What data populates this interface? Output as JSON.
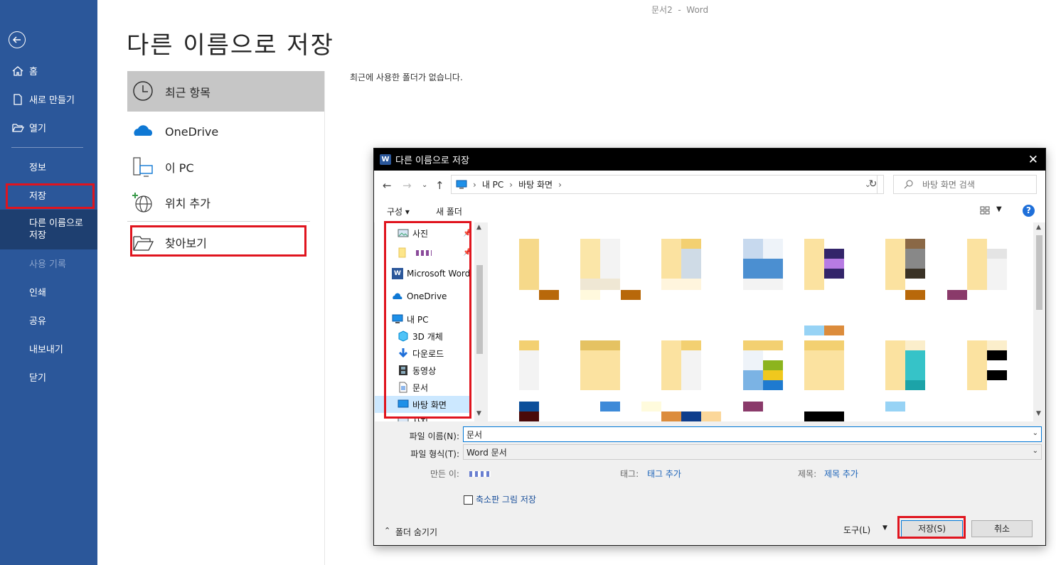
{
  "app_title": "문서2  -  Word",
  "page_title": "다른 이름으로 저장",
  "backstage_nav": {
    "items": [
      {
        "label": "홈"
      },
      {
        "label": "새로 만들기"
      },
      {
        "label": "열기"
      },
      {
        "label": "정보"
      },
      {
        "label": "저장"
      },
      {
        "label": "다른 이름으로\n저장"
      },
      {
        "label": "사용 기록"
      },
      {
        "label": "인쇄"
      },
      {
        "label": "공유"
      },
      {
        "label": "내보내기"
      },
      {
        "label": "닫기"
      }
    ]
  },
  "locations": {
    "recent": "최근 항목",
    "onedrive": "OneDrive",
    "this_pc": "이 PC",
    "add_place": "위치 추가",
    "browse": "찾아보기"
  },
  "empty_message": "최근에 사용한 폴더가 없습니다.",
  "dialog": {
    "title": "다른 이름으로 저장",
    "close": "✕",
    "address": {
      "root": "내 PC",
      "folder": "바탕 화면"
    },
    "search_placeholder": "바탕 화면 검색",
    "cmd": {
      "organize": "구성 ▾",
      "new_folder": "새 폴더"
    },
    "tree": [
      {
        "label": "사진"
      },
      {
        "label": ""
      },
      {
        "label": "Microsoft Word"
      },
      {
        "label": "OneDrive"
      },
      {
        "label": "내 PC"
      },
      {
        "label": "3D 개체"
      },
      {
        "label": "다운로드"
      },
      {
        "label": "동영상"
      },
      {
        "label": "문서"
      },
      {
        "label": "바탕 화면"
      },
      {
        "label": "사진"
      }
    ],
    "filename_label": "파일 이름(N):",
    "filename_value": "문서",
    "filetype_label": "파일 형식(T):",
    "filetype_value": "Word 문서",
    "author_label": "만든 이:",
    "tags_label": "태그:",
    "tags_value": "태그 추가",
    "title_label": "제목:",
    "title_value": "제목 추가",
    "thumbnail_label": "축소판 그림 저장",
    "hide_folders": "폴더 숨기기",
    "tools": "도구(L)",
    "save": "저장(S)",
    "cancel": "취소"
  },
  "colors": {
    "nav_bg": "#2b579a",
    "nav_selected": "#1e3f70",
    "highlight_red": "#e0141e",
    "link_blue": "#1a62b8"
  }
}
